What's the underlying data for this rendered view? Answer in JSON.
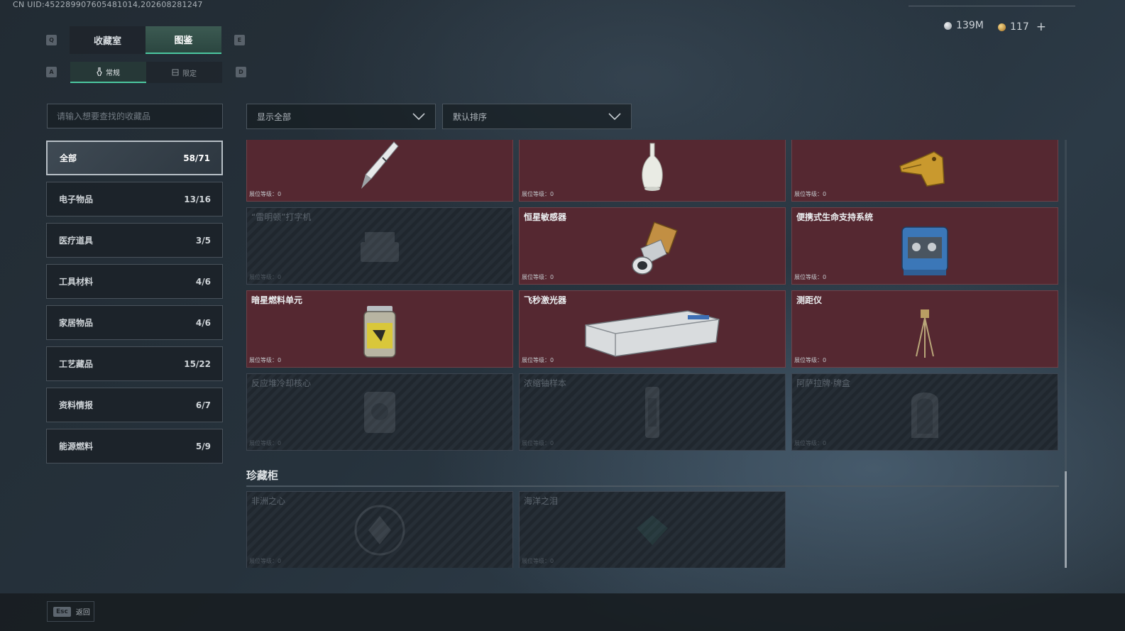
{
  "uid": "CN UID:452289907605481014,202608281247",
  "keys": {
    "q": "Q",
    "e": "E",
    "a": "A",
    "d": "D"
  },
  "tabs": [
    {
      "label": "收藏室",
      "active": false
    },
    {
      "label": "图鉴",
      "active": true
    }
  ],
  "subtabs": [
    {
      "label": "常规",
      "icon": "wrench-icon",
      "active": true
    },
    {
      "label": "限定",
      "icon": "box-icon",
      "active": false
    }
  ],
  "currency": [
    {
      "value": "139M",
      "icon": "silver-coin-icon",
      "color": "#c2c8cd"
    },
    {
      "value": "117",
      "icon": "gold-coin-icon",
      "color": "#d9a441"
    }
  ],
  "currency_add": "+",
  "search": {
    "placeholder": "请输入想要查找的收藏品"
  },
  "filters": {
    "show": {
      "label": "显示全部"
    },
    "sort": {
      "label": "默认排序"
    }
  },
  "categories": [
    {
      "label": "全部",
      "count": "58/71",
      "active": true
    },
    {
      "label": "电子物品",
      "count": "13/16",
      "active": false
    },
    {
      "label": "医疗道具",
      "count": "3/5",
      "active": false
    },
    {
      "label": "工具材料",
      "count": "4/6",
      "active": false
    },
    {
      "label": "家居物品",
      "count": "4/6",
      "active": false
    },
    {
      "label": "工艺藏品",
      "count": "15/22",
      "active": false
    },
    {
      "label": "资料情报",
      "count": "6/7",
      "active": false
    },
    {
      "label": "能源燃料",
      "count": "5/9",
      "active": false
    }
  ],
  "level_label": "展位等级：0",
  "items": [
    {
      "name": "",
      "icon": "pen-icon",
      "unlocked": true
    },
    {
      "name": "",
      "icon": "vase-icon",
      "unlocked": true
    },
    {
      "name": "",
      "icon": "gold-crocodile-head-icon",
      "unlocked": true
    },
    {
      "name": "“雷明顿”打字机",
      "icon": "typewriter-icon",
      "unlocked": false
    },
    {
      "name": "恒星敏感器",
      "icon": "star-sensor-icon",
      "unlocked": true
    },
    {
      "name": "便携式生命支持系统",
      "icon": "life-support-icon",
      "unlocked": true
    },
    {
      "name": "暗星燃料单元",
      "icon": "fuel-cell-icon",
      "unlocked": true
    },
    {
      "name": "飞秒激光器",
      "icon": "laser-box-icon",
      "unlocked": true
    },
    {
      "name": "测距仪",
      "icon": "tripod-icon",
      "unlocked": true
    },
    {
      "name": "反应堆冷却核心",
      "icon": "reactor-core-icon",
      "unlocked": false
    },
    {
      "name": "浓缩铀样本",
      "icon": "uranium-sample-icon",
      "unlocked": false
    },
    {
      "name": "阿萨拉牌·牌盒",
      "icon": "card-box-icon",
      "unlocked": false
    }
  ],
  "vault": {
    "title": "珍藏柜",
    "items": [
      {
        "name": "非洲之心",
        "icon": "heart-gem-icon",
        "unlocked": false
      },
      {
        "name": "海洋之泪",
        "icon": "tear-gem-icon",
        "unlocked": false
      }
    ]
  },
  "footer": {
    "esc_key": "Esc",
    "esc_label": "返回"
  }
}
